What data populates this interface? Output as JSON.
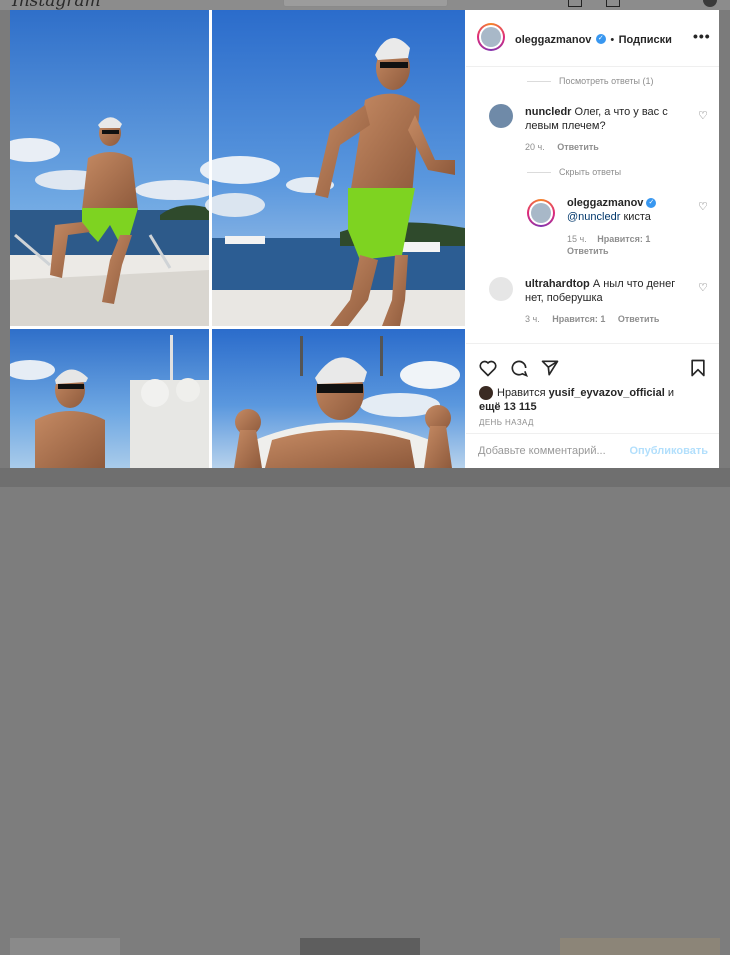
{
  "app": {
    "logo_text": "Instagram"
  },
  "post": {
    "author": "oleggazmanov",
    "follow_label": "Подписки",
    "more_label": "•••"
  },
  "comments": {
    "view_replies": "Посмотреть ответы (1)",
    "c1": {
      "user": "nuncledr",
      "text": "Олег, а что у вас с левым плечем?",
      "time": "20 ч.",
      "reply": "Ответить"
    },
    "hide_replies": "Скрыть ответы",
    "r1": {
      "user": "oleggazmanov",
      "mention": "@nuncledr",
      "text": "киста",
      "time": "15 ч.",
      "likes": "Нравится: 1",
      "reply": "Ответить"
    },
    "c2": {
      "user": "ultrahardtop",
      "text": "А ныл что денег нет, поберушка",
      "time": "3 ч.",
      "likes": "Нравится: 1",
      "reply": "Ответить"
    }
  },
  "likes": {
    "prefix": "Нравится",
    "user": "yusif_eyvazov_official",
    "suffix": "и",
    "more": "ещё 13 115"
  },
  "date": "ДЕНЬ НАЗАД",
  "comment_input": {
    "placeholder": "Добавьте комментарий...",
    "publish": "Опубликовать"
  },
  "icons": [
    "heart-icon",
    "comment-icon",
    "share-icon",
    "bookmark-icon",
    "verified-icon",
    "more-icon"
  ],
  "colors": {
    "verified": "#3897f0",
    "publish": "#b2dffc",
    "shorts": "#7ed321"
  }
}
